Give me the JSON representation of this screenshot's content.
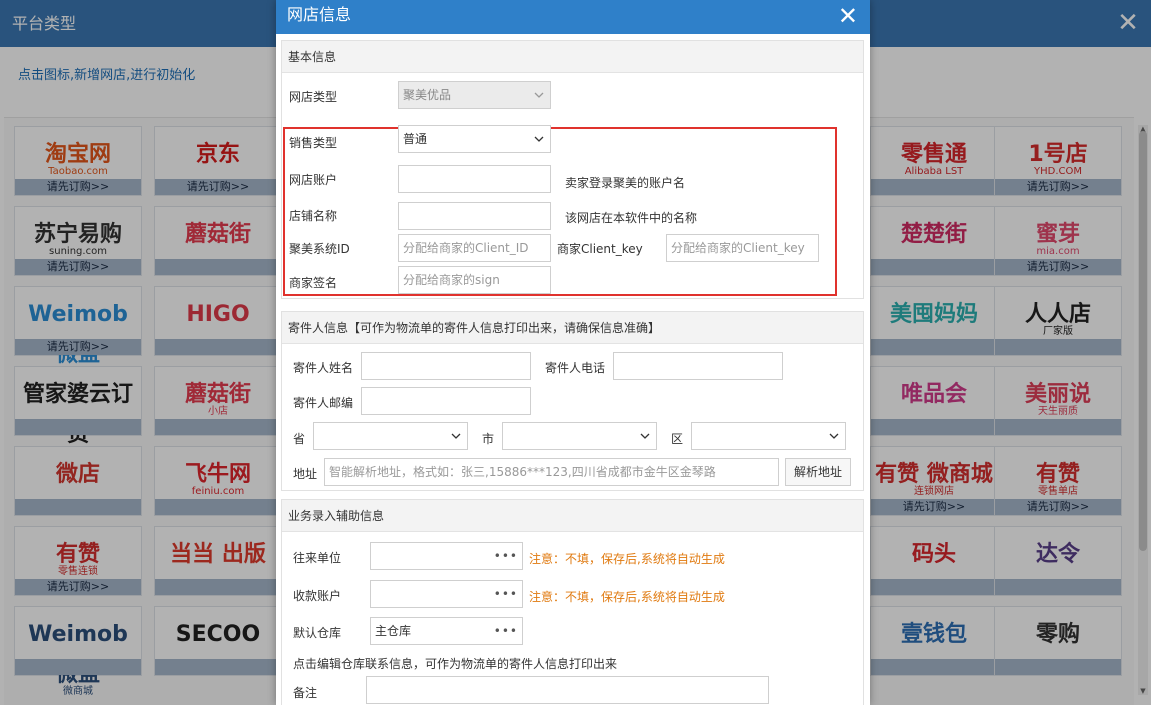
{
  "background": {
    "title": "平台类型",
    "hint": "点击图标,新增网店,进行初始化",
    "subscribe_label": "请先订购>>",
    "tiles": [
      {
        "logo": "淘宝网",
        "sub": "Taobao.com",
        "color": "#e4571b",
        "bar": "请先订购>>"
      },
      {
        "logo": "京东",
        "sub": "",
        "color": "#d71c1c",
        "bar": "请先订购>>"
      },
      {
        "logo": "苏宁易购",
        "sub": "suning.com",
        "color": "#333333",
        "bar": "请先订购>>"
      },
      {
        "logo": "蘑菇街",
        "sub": "",
        "color": "#e63b50",
        "bar": ""
      },
      {
        "logo": "Weimob 微盟",
        "sub": "",
        "color": "#2c8fd6",
        "bar": "请先订购>>"
      },
      {
        "logo": "HIGO",
        "sub": "",
        "color": "#e03a4a",
        "bar": ""
      },
      {
        "logo": "管家婆云订货",
        "sub": "",
        "color": "#222222",
        "bar": ""
      },
      {
        "logo": "蘑菇街",
        "sub": "小店",
        "color": "#e63b50",
        "bar": ""
      },
      {
        "logo": "微店",
        "sub": "",
        "color": "#d3352f",
        "bar": ""
      },
      {
        "logo": "飞牛网",
        "sub": "feiniu.com",
        "color": "#e0262d",
        "bar": ""
      },
      {
        "logo": "有赞",
        "sub": "零售连锁",
        "color": "#d42f2f",
        "bar": "请先订购>>"
      },
      {
        "logo": "当当 出版",
        "sub": "",
        "color": "#e03a2c",
        "bar": ""
      },
      {
        "logo": "Weimob 微盟",
        "sub": "微商城",
        "color": "#2c4f7c",
        "bar": ""
      },
      {
        "logo": "SECOO",
        "sub": "",
        "color": "#222222",
        "bar": ""
      },
      {
        "logo": "零售通",
        "sub": "Alibaba LST",
        "color": "#d7262b",
        "bar": ""
      },
      {
        "logo": "1号店",
        "sub": "YHD.COM",
        "color": "#d72c2c",
        "bar": "请先订购>>"
      },
      {
        "logo": "楚楚街",
        "sub": "",
        "color": "#d12a63",
        "bar": ""
      },
      {
        "logo": "蜜芽",
        "sub": "mia.com",
        "color": "#e2496e",
        "bar": "请先订购>>"
      },
      {
        "logo": "美囤妈妈",
        "sub": "",
        "color": "#2bb0b0",
        "bar": ""
      },
      {
        "logo": "人人店",
        "sub": "厂家版",
        "color": "#222222",
        "bar": ""
      },
      {
        "logo": "唯品会",
        "sub": "",
        "color": "#d23b8c",
        "bar": ""
      },
      {
        "logo": "美丽说",
        "sub": "天生丽质",
        "color": "#e0405a",
        "bar": ""
      },
      {
        "logo": "有赞 微商城",
        "sub": "连锁网店",
        "color": "#d42f2f",
        "bar": "请先订购>>"
      },
      {
        "logo": "有赞",
        "sub": "零售单店",
        "color": "#d42f2f",
        "bar": "请先订购>>"
      },
      {
        "logo": "码头",
        "sub": "",
        "color": "#d8262d",
        "bar": ""
      },
      {
        "logo": "达令",
        "sub": "",
        "color": "#5a3f8a",
        "bar": ""
      },
      {
        "logo": "壹钱包",
        "sub": "",
        "color": "#2d6fb5",
        "bar": ""
      },
      {
        "logo": "零购",
        "sub": "",
        "color": "#333333",
        "bar": ""
      }
    ]
  },
  "modal": {
    "title": "网店信息",
    "close_icon": "close-icon",
    "basic": {
      "title": "基本信息",
      "shop_type_label": "网店类型",
      "shop_type_value": "聚美优品",
      "sale_type_label": "销售类型",
      "sale_type_value": "普通",
      "account_label": "网店账户",
      "account_value": "",
      "account_hint": "卖家登录聚美的账户名",
      "shop_name_label": "店铺名称",
      "shop_name_value": "",
      "shop_name_hint": "该网店在本软件中的名称",
      "system_id_label": "聚美系统ID",
      "system_id_placeholder": "分配给商家的Client_ID",
      "client_key_label": "商家Client_key",
      "client_key_placeholder": "分配给商家的Client_key",
      "sign_label": "商家签名",
      "sign_placeholder": "分配给商家的sign"
    },
    "sender": {
      "title": "寄件人信息【可作为物流单的寄件人信息打印出来，请确保信息准确】",
      "name_label": "寄件人姓名",
      "phone_label": "寄件人电话",
      "email_label": "寄件人邮编",
      "province_label": "省",
      "city_label": "市",
      "district_label": "区",
      "address_label": "地址",
      "address_placeholder": "智能解析地址，格式如：张三,15886***123,四川省成都市金牛区金琴路",
      "parse_button": "解析地址"
    },
    "business": {
      "title": "业务录入辅助信息",
      "partner_label": "往来单位",
      "partner_note": "注意：不填，保存后,系统将自动生成",
      "account_label": "收款账户",
      "account_note": "注意：不填，保存后,系统将自动生成",
      "warehouse_label": "默认仓库",
      "warehouse_value": "主仓库",
      "edit_warehouse_note": "点击编辑仓库联系信息，可作为物流单的寄件人信息打印出来",
      "remark_label": "备注",
      "more_dots": "•••"
    }
  }
}
